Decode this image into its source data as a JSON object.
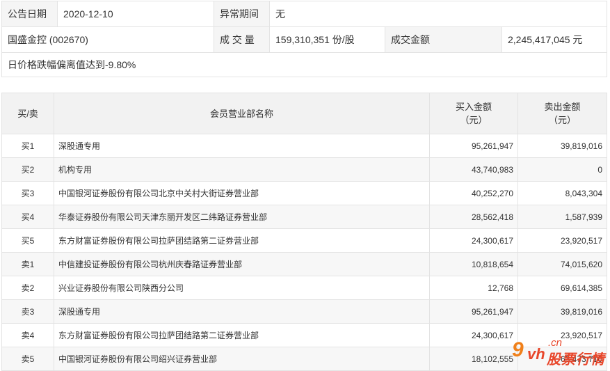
{
  "info": {
    "date_label": "公告日期",
    "date_value": "2020-12-10",
    "abnormal_label": "异常期间",
    "abnormal_value": "无",
    "stock": "国盛金控 (002670)",
    "volume_label": "成 交 量",
    "volume_value": "159,310,351 份/股",
    "amount_label": "成交金额",
    "amount_value": "2,245,417,045 元",
    "reason": "日价格跌幅偏离值达到-9.80%"
  },
  "headers": {
    "side": "买/卖",
    "member": "会员营业部名称",
    "buy": "买入金额",
    "buy_unit": "（元）",
    "sell": "卖出金额",
    "sell_unit": "（元）"
  },
  "rows": [
    {
      "side": "买1",
      "name": "深股通专用",
      "buy": "95,261,947",
      "sell": "39,819,016"
    },
    {
      "side": "买2",
      "name": "机构专用",
      "buy": "43,740,983",
      "sell": "0"
    },
    {
      "side": "买3",
      "name": "中国银河证券股份有限公司北京中关村大街证券营业部",
      "buy": "40,252,270",
      "sell": "8,043,304"
    },
    {
      "side": "买4",
      "name": "华泰证券股份有限公司天津东丽开发区二纬路证券营业部",
      "buy": "28,562,418",
      "sell": "1,587,939"
    },
    {
      "side": "买5",
      "name": "东方财富证券股份有限公司拉萨团结路第二证券营业部",
      "buy": "24,300,617",
      "sell": "23,920,517"
    },
    {
      "side": "卖1",
      "name": "中信建投证券股份有限公司杭州庆春路证券营业部",
      "buy": "10,818,654",
      "sell": "74,015,620"
    },
    {
      "side": "卖2",
      "name": "兴业证券股份有限公司陕西分公司",
      "buy": "12,768",
      "sell": "69,614,385"
    },
    {
      "side": "卖3",
      "name": "深股通专用",
      "buy": "95,261,947",
      "sell": "39,819,016"
    },
    {
      "side": "卖4",
      "name": "东方财富证券股份有限公司拉萨团结路第二证券营业部",
      "buy": "24,300,617",
      "sell": "23,920,517"
    },
    {
      "side": "卖5",
      "name": "中国银河证券股份有限公司绍兴证券营业部",
      "buy": "18,102,555",
      "sell": "63,473,710"
    }
  ],
  "watermark": {
    "nine": "9",
    "vh": "vh",
    "cn": ".cn",
    "text": "股票行情"
  }
}
